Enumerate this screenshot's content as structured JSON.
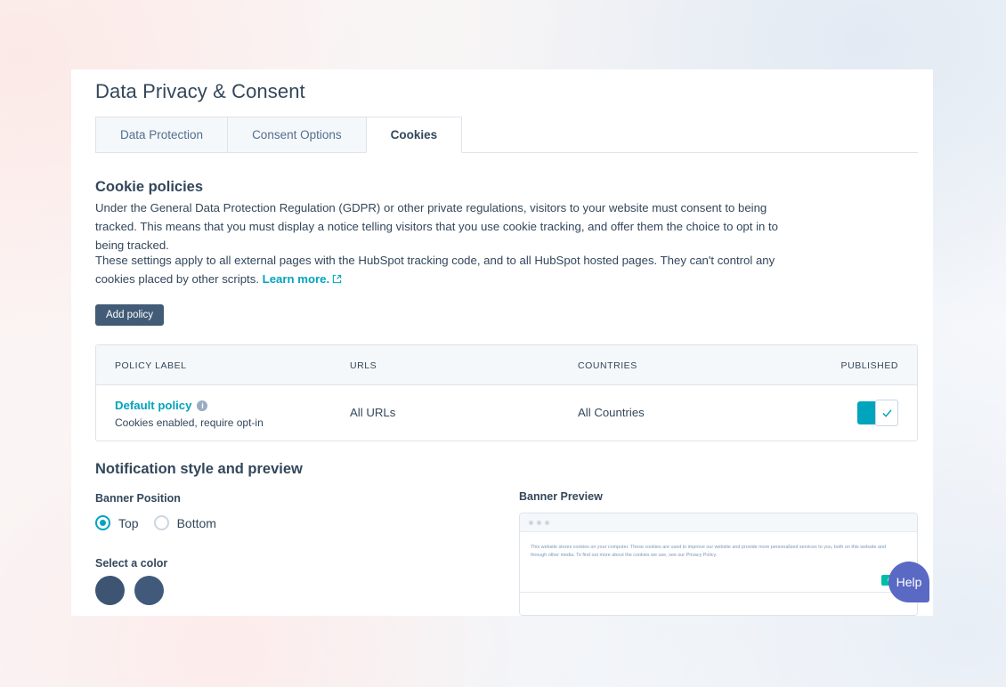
{
  "page": {
    "title": "Data Privacy & Consent"
  },
  "tabs": [
    {
      "label": "Data Protection",
      "active": false
    },
    {
      "label": "Consent Options",
      "active": false
    },
    {
      "label": "Cookies",
      "active": true
    }
  ],
  "cookie_policies": {
    "heading": "Cookie policies",
    "paragraph_1": "Under the General Data Protection Regulation (GDPR) or other private regulations, visitors to your website must consent to being tracked. This means that you must display a notice telling visitors that you use cookie tracking, and offer them the choice to opt in to being tracked.",
    "paragraph_2_before_link": "These settings apply to all external pages with the HubSpot tracking code, and to all HubSpot hosted pages. They can't control any cookies placed by other scripts. ",
    "learn_more_label": "Learn more.",
    "add_policy_label": "Add policy"
  },
  "table": {
    "columns": [
      "POLICY LABEL",
      "URLS",
      "COUNTRIES",
      "PUBLISHED"
    ],
    "rows": [
      {
        "policy_label": "Default policy",
        "policy_sublabel": "Cookies enabled, require opt-in",
        "urls": "All URLs",
        "countries": "All Countries",
        "published": true
      }
    ]
  },
  "notification": {
    "heading": "Notification style and preview",
    "banner_position_label": "Banner Position",
    "position_options": [
      {
        "label": "Top",
        "selected": true
      },
      {
        "label": "Bottom",
        "selected": false
      }
    ],
    "select_color_label": "Select a color",
    "swatches": [
      "#3d5573",
      "#41597a"
    ]
  },
  "preview": {
    "heading": "Banner Preview",
    "banner_text": "This website stores cookies on your computer. These cookies are used to improve our website and provide more personalized services to you, both on this website and through other media. To find out more about the cookies we use, see our Privacy Policy.",
    "accept_label": "Accept"
  },
  "help_widget": {
    "label": "Help"
  },
  "colors": {
    "accent_teal": "#00a4bd",
    "primary_dark": "#425b76",
    "accept_green": "#00bda5",
    "help_purple": "#5a69c4"
  }
}
